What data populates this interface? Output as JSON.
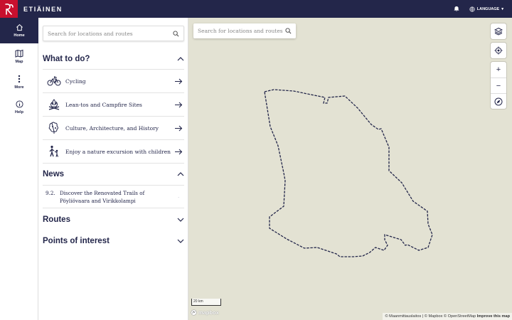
{
  "app": {
    "brand": "ETIÄINEN",
    "language_label": "LANGUAGE"
  },
  "rail": {
    "items": [
      {
        "label": "Home",
        "icon": "home-icon",
        "active": true
      },
      {
        "label": "Map",
        "icon": "map-icon"
      },
      {
        "label": "More",
        "icon": "more-icon"
      },
      {
        "label": "Help",
        "icon": "info-icon"
      }
    ]
  },
  "panel": {
    "search_placeholder": "Search for locations and routes",
    "what_to_do": {
      "title": "What to do?",
      "items": [
        {
          "label": "Cycling",
          "icon": "bicycle-icon"
        },
        {
          "label": "Lean-tos and Campfire Sites",
          "icon": "campfire-icon"
        },
        {
          "label": "Culture, Architecture, and History",
          "icon": "culture-icon"
        },
        {
          "label": "Enjoy a nature excursion with children",
          "icon": "family-walk-icon"
        }
      ]
    },
    "news": {
      "title": "News",
      "items": [
        {
          "date": "9.2.",
          "title": "Discover the Renovated Trails of Pöyliövaara and Virikkolampi"
        }
      ]
    },
    "routes": {
      "title": "Routes"
    },
    "poi": {
      "title": "Points of interest"
    }
  },
  "map": {
    "search_placeholder": "Search for locations and routes",
    "scale_label": "20 km",
    "logo_text": "mapbox",
    "attribution": "© Maanmittauslaitos | © Mapbox © OpenStreetMap",
    "improve_link": "Improve this map",
    "colors": {
      "route": "#23264a",
      "background": "#e3e2d3"
    }
  }
}
